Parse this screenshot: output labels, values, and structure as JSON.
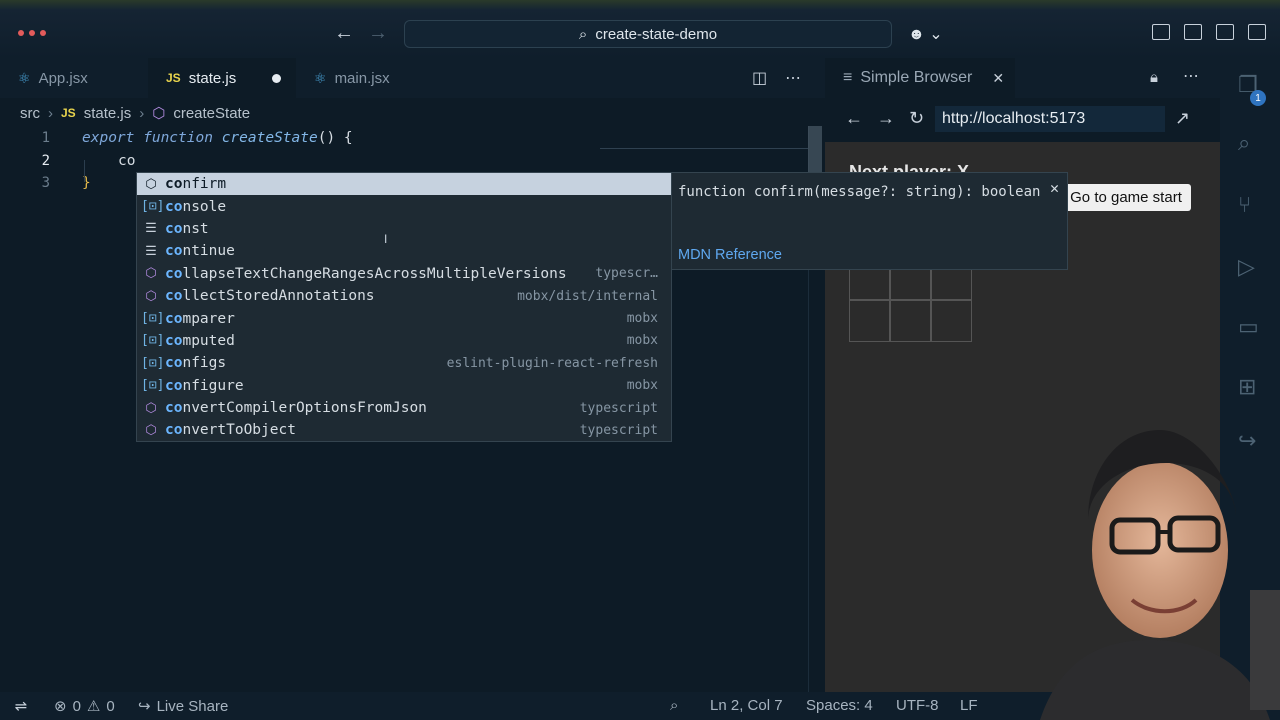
{
  "window": {
    "command_center": "create-state-demo"
  },
  "tabs": [
    {
      "label": "App.jsx",
      "icon": "react-icon",
      "active": false
    },
    {
      "label": "state.js",
      "icon": "js-icon",
      "active": true,
      "dirty": true
    },
    {
      "label": "main.jsx",
      "icon": "react-icon",
      "active": false
    }
  ],
  "breadcrumb": {
    "folder": "src",
    "file": "state.js",
    "symbol": "createState"
  },
  "editor": {
    "lines": [
      {
        "number": "1",
        "keyword": "export function",
        "name": "createState",
        "rest": "() {"
      },
      {
        "number": "2",
        "text": "co"
      },
      {
        "number": "3",
        "text": "}"
      }
    ]
  },
  "suggestions": [
    {
      "match": "co",
      "rest": "nfirm",
      "detail": "",
      "kind": "method",
      "selected": true
    },
    {
      "match": "co",
      "rest": "nsole",
      "detail": "",
      "kind": "variable"
    },
    {
      "match": "co",
      "rest": "nst",
      "detail": "",
      "kind": "keyword"
    },
    {
      "match": "co",
      "rest": "ntinue",
      "detail": "",
      "kind": "keyword"
    },
    {
      "match": "co",
      "rest": "llapseTextChangeRangesAcrossMultipleVersions",
      "detail": "typescr…",
      "kind": "method"
    },
    {
      "match": "co",
      "rest": "llectStoredAnnotations",
      "detail": "mobx/dist/internal",
      "kind": "method"
    },
    {
      "match": "co",
      "rest": "mparer",
      "detail": "mobx",
      "kind": "variable"
    },
    {
      "match": "co",
      "rest": "mputed",
      "detail": "mobx",
      "kind": "variable"
    },
    {
      "match": "co",
      "rest": "nfigs",
      "detail": "eslint-plugin-react-refresh",
      "kind": "variable"
    },
    {
      "match": "co",
      "rest": "nfigure",
      "detail": "mobx",
      "kind": "variable"
    },
    {
      "match": "co",
      "rest": "nvertCompilerOptionsFromJson",
      "detail": "typescript",
      "kind": "method"
    },
    {
      "match": "co",
      "rest": "nvertToObject",
      "detail": "typescript",
      "kind": "method"
    }
  ],
  "details": {
    "signature": "function confirm(message?: string): boolean",
    "link": "MDN Reference"
  },
  "browser": {
    "tab_label": "Simple Browser",
    "url": "http://localhost:5173",
    "page_heading": "Next player: X",
    "button_label": "Go to game start"
  },
  "activity_badge": "1",
  "status": {
    "errors": "0",
    "warnings": "0",
    "live_share": "Live Share",
    "position": "Ln 2, Col 7",
    "spaces": "Spaces: 4",
    "encoding": "UTF-8",
    "eol": "LF"
  },
  "colors": {
    "background": "#0d1b26",
    "selection": "#c6d2df",
    "match_highlight": "#6cb6ff",
    "link": "#5fa8f0"
  }
}
